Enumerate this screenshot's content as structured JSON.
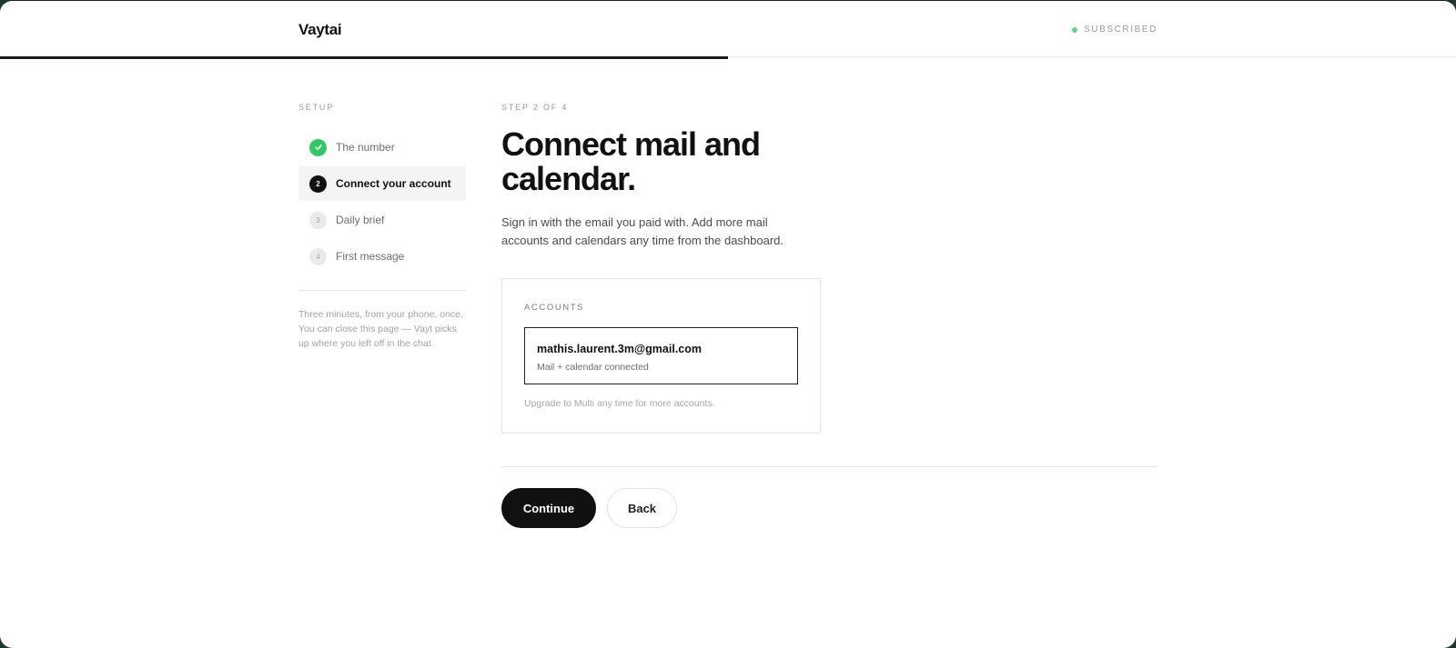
{
  "app": {
    "brand": "Vaytai",
    "status_label": "SUBSCRIBED",
    "status_color": "#5fd38a",
    "progress": 0.5
  },
  "sidebar": {
    "title": "SETUP",
    "steps": [
      {
        "marker": "",
        "label": "The number",
        "state": "done"
      },
      {
        "marker": "2",
        "label": "Connect your account",
        "state": "current"
      },
      {
        "marker": "3",
        "label": "Daily brief",
        "state": "pending"
      },
      {
        "marker": "4",
        "label": "First message",
        "state": "pending"
      }
    ],
    "note": "Three minutes, from your phone, once. You can close this page — Vayt picks up where you left off in the chat."
  },
  "main": {
    "eyebrow": "STEP 2 OF 4",
    "title": "Connect mail and calendar.",
    "subtitle": "Sign in with the email you paid with. Add more mail accounts and calendars any time from the dashboard.",
    "accounts": {
      "title": "ACCOUNTS",
      "items": [
        {
          "email": "mathis.laurent.3m@gmail.com",
          "status": "Mail + calendar connected"
        }
      ],
      "upgrade_note": "Upgrade to Multi any time for more accounts."
    },
    "actions": {
      "continue_label": "Continue",
      "back_label": "Back"
    }
  }
}
